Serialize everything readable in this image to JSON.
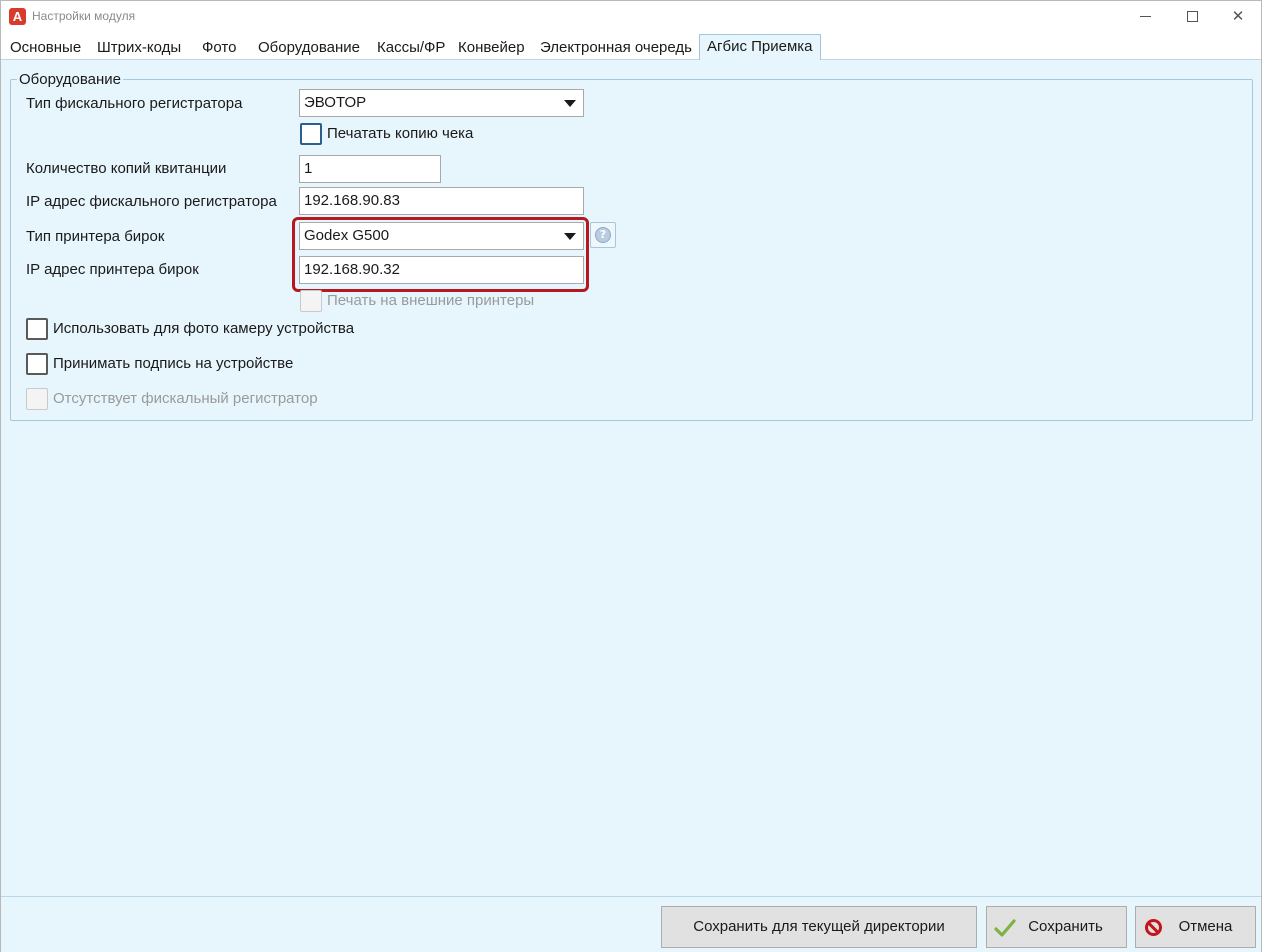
{
  "window": {
    "title": "Настройки модуля"
  },
  "tabs": [
    {
      "label": "Основные"
    },
    {
      "label": "Штрих-коды"
    },
    {
      "label": "Фото"
    },
    {
      "label": "Оборудование"
    },
    {
      "label": "Кассы/ФР"
    },
    {
      "label": "Конвейер"
    },
    {
      "label": "Электронная очередь"
    },
    {
      "label": "Агбис Приемка",
      "active": true
    }
  ],
  "group": {
    "legend": "Оборудование",
    "fiscal_type_label": "Тип фискального регистратора",
    "fiscal_type_value": "ЭВОТОР",
    "print_copy_label": "Печатать копию чека",
    "copies_label": "Количество копий квитанции",
    "copies_value": "1",
    "fiscal_ip_label": "IP адрес фискального регистратора",
    "fiscal_ip_value": "192.168.90.83",
    "tag_printer_type_label": "Тип принтера бирок",
    "tag_printer_type_value": "Godex G500",
    "tag_printer_ip_label": "IP адрес принтера бирок",
    "tag_printer_ip_value": "192.168.90.32",
    "external_print_label": "Печать на внешние принтеры",
    "use_camera_label": "Использовать для фото камеру устройства",
    "accept_signature_label": "Принимать подпись на устройстве",
    "no_fiscal_label": "Отсутствует фискальный регистратор"
  },
  "footer": {
    "save_dir_label": "Сохранить для текущей директории",
    "save_label": "Сохранить",
    "cancel_label": "Отмена"
  },
  "colors": {
    "content_bg": "#e7f6fd",
    "highlight": "#b5191f",
    "cancel_icon": "#c2161b",
    "check_icon": "#7cb342"
  }
}
